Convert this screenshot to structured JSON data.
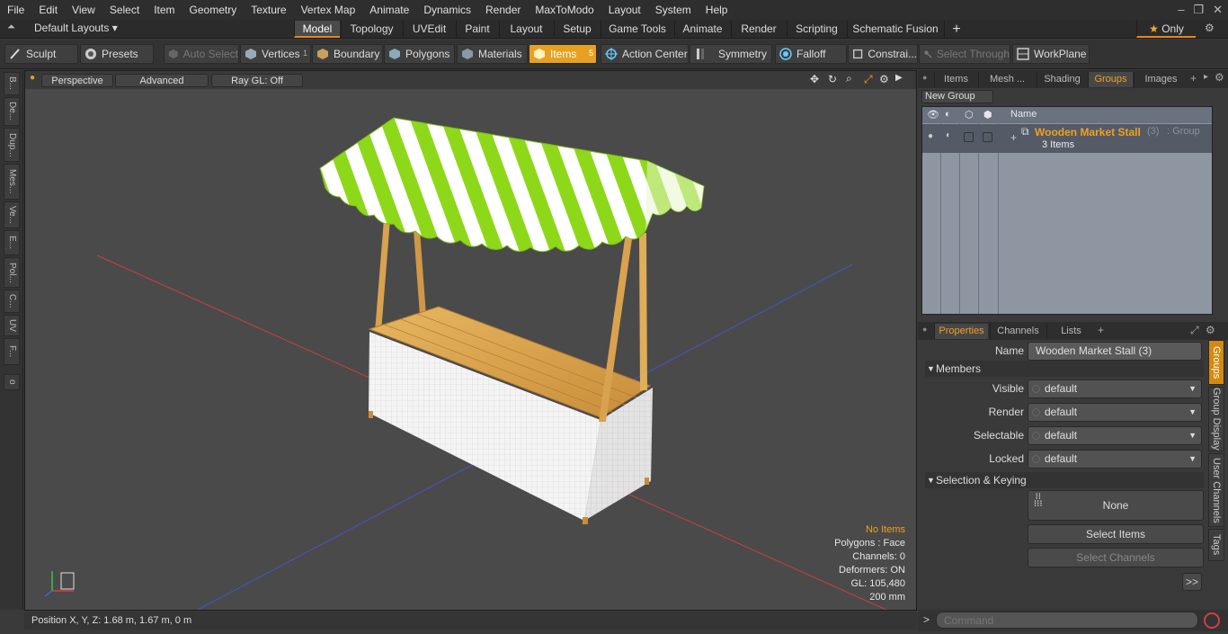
{
  "menu": [
    "File",
    "Edit",
    "View",
    "Select",
    "Item",
    "Geometry",
    "Texture",
    "Vertex Map",
    "Animate",
    "Dynamics",
    "Render",
    "MaxToModo",
    "Layout",
    "System",
    "Help"
  ],
  "layout_selector": "Default Layouts ▾",
  "mode_tabs": [
    "Model",
    "Topology",
    "UVEdit",
    "Paint",
    "Layout",
    "Setup",
    "Game Tools",
    "Animate",
    "Render",
    "Scripting",
    "Schematic Fusion"
  ],
  "mode_active": "Model",
  "only_label": "Only",
  "toolbar": {
    "sculpt": "Sculpt",
    "presets": "Presets",
    "auto_select": "Auto Select",
    "vertices": "Vertices",
    "vertices_count": "1",
    "boundary": "Boundary",
    "polygons": "Polygons",
    "materials": "Materials",
    "items": "Items",
    "items_count": "5",
    "action_center": "Action Center",
    "symmetry": "Symmetry",
    "falloff": "Falloff",
    "constraints": "Constrai...",
    "select_through": "Select Through",
    "workplane": "WorkPlane"
  },
  "left_tabs": [
    "B...",
    "De...",
    "Dup...",
    "Mes...",
    "Ve...",
    "E...",
    "Pol...",
    "C...",
    "UV",
    "F..."
  ],
  "viewport": {
    "perspective": "Perspective",
    "advanced": "Advanced",
    "raygl": "Ray GL: Off",
    "info": {
      "no_items": "No Items",
      "polygons": "Polygons : Face",
      "channels": "Channels: 0",
      "deformers": "Deformers: ON",
      "gl": "GL: 105,480",
      "scale": "200 mm"
    }
  },
  "status": "Position X, Y, Z:   1.68 m, 1.67 m, 0 m",
  "right_top_tabs": [
    "Items",
    "Mesh ...",
    "Shading",
    "Groups",
    "Images"
  ],
  "right_top_active": "Groups",
  "new_group": "New Group",
  "group_list": {
    "name_header": "Name",
    "group_name": "Wooden Market Stall",
    "group_count": "(3)",
    "group_type": ": Group",
    "group_items": "3 Items"
  },
  "props_tabs": [
    "Properties",
    "Channels",
    "Lists"
  ],
  "props_active": "Properties",
  "props": {
    "name_label": "Name",
    "name_value": "Wooden Market Stall (3)",
    "members": "Members",
    "visible_label": "Visible",
    "render_label": "Render",
    "selectable_label": "Selectable",
    "locked_label": "Locked",
    "default": "default",
    "sel_keying": "Selection & Keying",
    "none": "None",
    "select_items": "Select Items",
    "select_channels": "Select Channels",
    "more": ">>"
  },
  "side_tabs": [
    "Groups",
    "Group Display",
    "User Channels",
    "Tags"
  ],
  "command_placeholder": "Command",
  "colors": {
    "accent": "#e8a020",
    "viewport": "#4a4a4a",
    "stripe_green": "#8ed81a"
  }
}
